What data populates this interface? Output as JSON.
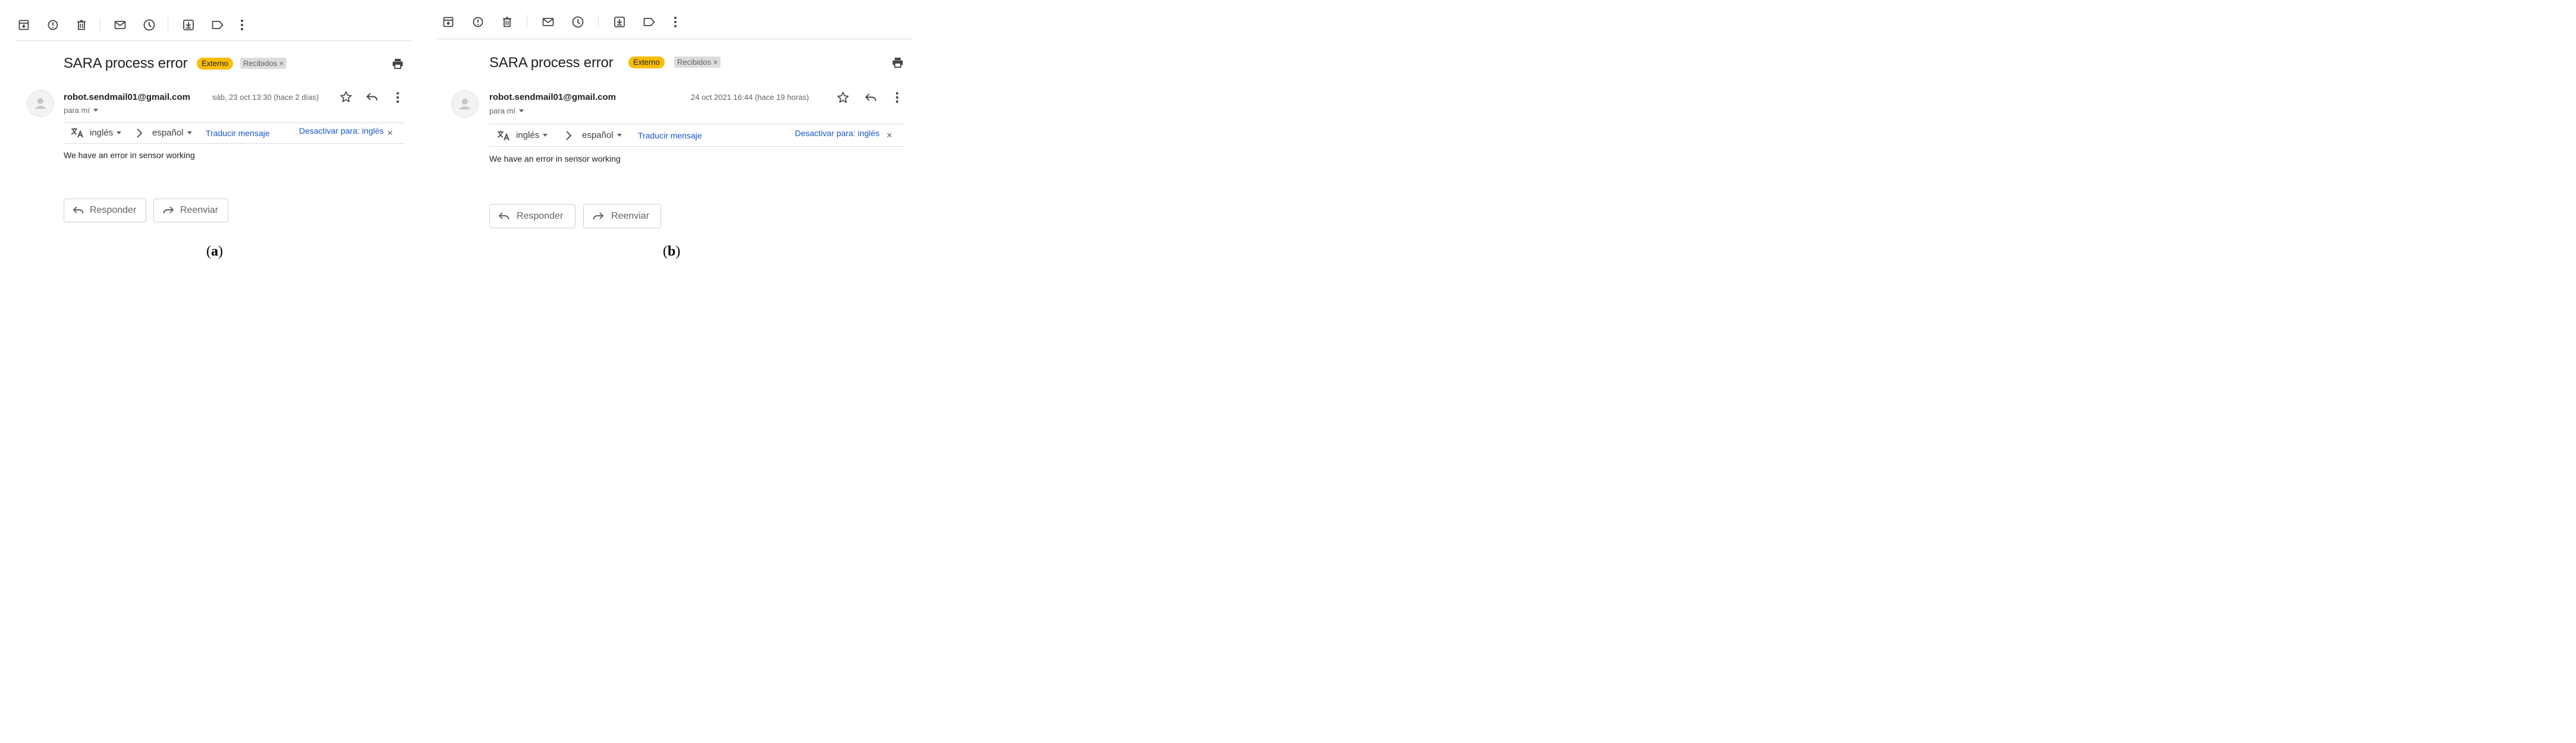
{
  "panels": [
    {
      "id": "a",
      "caption": "a",
      "subject": "SARA process error",
      "badges": {
        "external": "Externo",
        "inbox": "Recibidos ×"
      },
      "sender": "robot.sendmail01@gmail.com",
      "to": "para mí",
      "date": "sáb, 23 oct 13:30 (hace 2 días)",
      "translate": {
        "from_lang": "inglés",
        "to_lang": "español",
        "translate_link": "Traducir mensaje",
        "disable_link": "Desactivar para: inglés",
        "close": "×"
      },
      "body": "We have an error in sensor working",
      "buttons": {
        "reply": "Responder",
        "forward": "Reenviar"
      }
    },
    {
      "id": "b",
      "caption": "b",
      "subject": "SARA process error",
      "badges": {
        "external": "Externo",
        "inbox": "Recibidos ×"
      },
      "sender": "robot.sendmail01@gmail.com",
      "to": "para mí",
      "date": "24 oct 2021 16:44 (hace 19 horas)",
      "translate": {
        "from_lang": "inglés",
        "to_lang": "español",
        "translate_link": "Traducir mensaje",
        "disable_link": "Desactivar para: inglés",
        "close": "×"
      },
      "body": "We have an error in sensor working",
      "buttons": {
        "reply": "Responder",
        "forward": "Reenviar"
      }
    }
  ],
  "toolbar_icons": [
    "archive-icon",
    "report-spam-icon",
    "delete-icon",
    "mark-unread-icon",
    "snooze-icon",
    "move-to-icon",
    "label-icon",
    "more-vert-icon"
  ],
  "colors": {
    "external_badge": "#fbbc04",
    "link": "#1a57c7",
    "inbox_badge": "#dddddd"
  }
}
